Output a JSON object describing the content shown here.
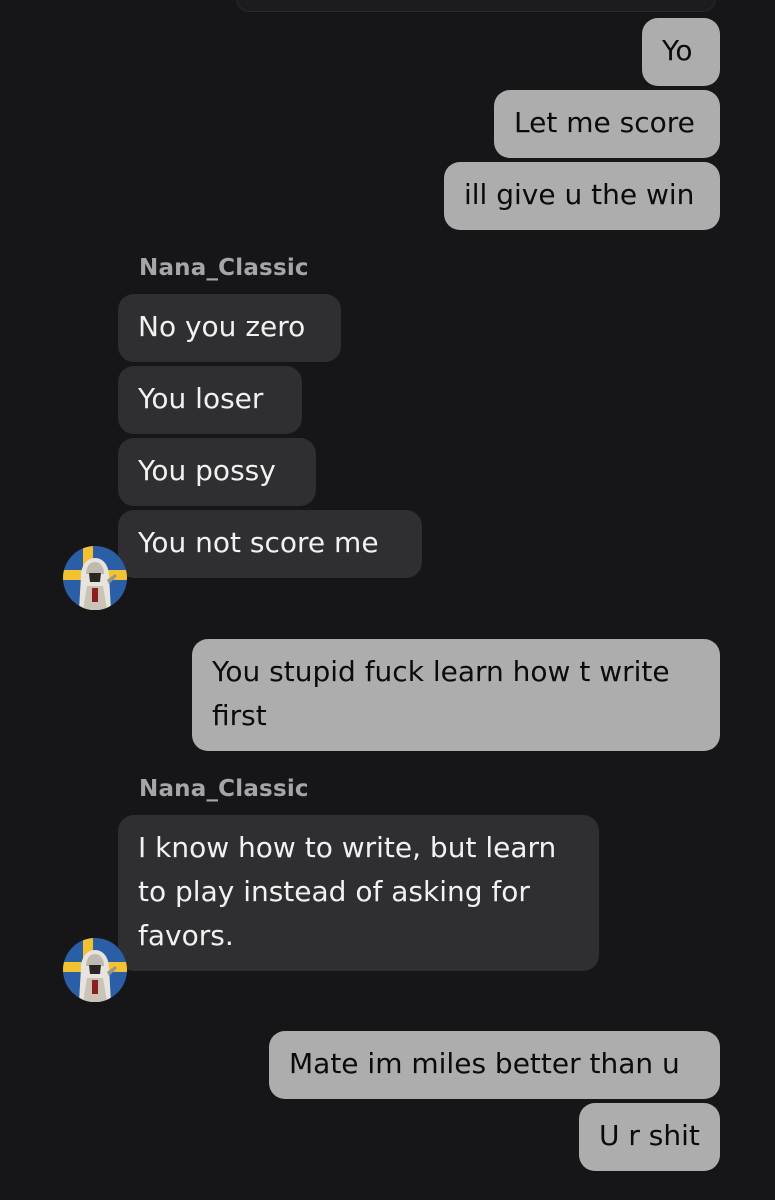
{
  "conversation": {
    "contact_name": "Nana_Classic",
    "avatar_icon": "swedish-flag-hooded-warrior-avatar",
    "colors": {
      "background": "#161618",
      "outgoing_bubble": "#adadad",
      "incoming_bubble": "#2f2f32",
      "sender_label": "#a6a6a9"
    },
    "messages": {
      "m1": "Yo",
      "m2": "Let me score",
      "m3": "ill give u the win",
      "m4": "No you zero",
      "m5": "You loser",
      "m6": "You possy",
      "m7": "You not score me",
      "m8": "You stupid fuck learn how t write first",
      "m9": "I know how to write, but learn to play instead of asking for favors.",
      "m10": "Mate im miles better than u",
      "m11": "U r shit"
    }
  }
}
